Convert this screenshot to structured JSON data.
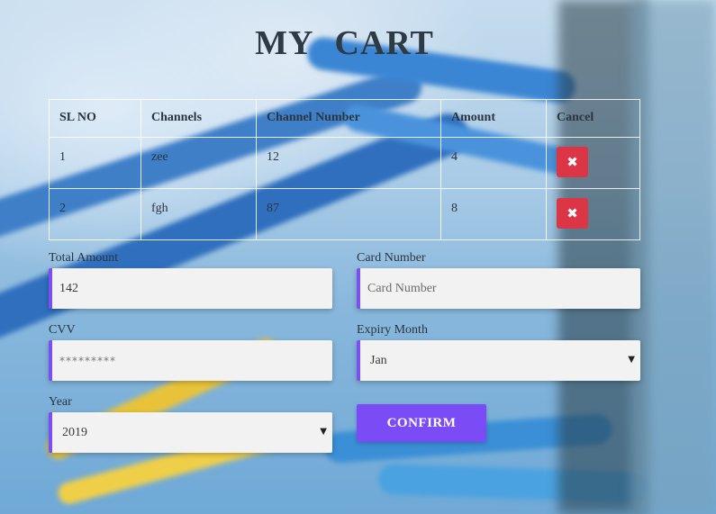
{
  "page": {
    "title": "MY   CART"
  },
  "table": {
    "headers": [
      "SL NO",
      "Channels",
      "Channel Number",
      "Amount",
      "Cancel"
    ],
    "rows": [
      {
        "sl": "1",
        "channel": "zee",
        "number": "12",
        "amount": "4"
      },
      {
        "sl": "2",
        "channel": "fgh",
        "number": "87",
        "amount": "8"
      }
    ],
    "cancel_icon": "times-icon",
    "cancel_glyph": "✖"
  },
  "form": {
    "total_amount": {
      "label": "Total Amount",
      "value": "142"
    },
    "card_number": {
      "label": "Card Number",
      "placeholder": "Card Number"
    },
    "cvv": {
      "label": "CVV",
      "value": "*********"
    },
    "expiry_month": {
      "label": "Expiry Month",
      "value": "Jan"
    },
    "year": {
      "label": "Year",
      "value": "2019"
    },
    "select_arrow": "▼",
    "confirm_label": "CONFIRM"
  },
  "colors": {
    "accent": "#7b4cf5",
    "danger": "#dc3545",
    "field_bg": "#f2f2f2"
  }
}
